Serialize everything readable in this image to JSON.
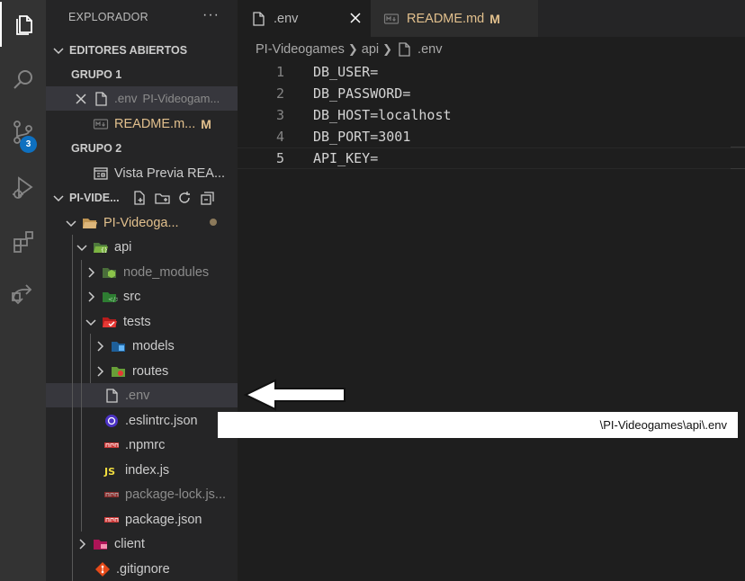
{
  "activity_bar": {
    "items": [
      {
        "icon": "files-icon",
        "active": true
      },
      {
        "icon": "search-icon"
      },
      {
        "icon": "source-control-icon",
        "badge": "3"
      },
      {
        "icon": "run-debug-icon"
      },
      {
        "icon": "extensions-icon"
      },
      {
        "icon": "remote-icon"
      }
    ]
  },
  "sidebar": {
    "title": "EXPLORADOR",
    "more": "···",
    "open_editors": {
      "label": "EDITORES ABIERTOS",
      "group1": "GRUPO 1",
      "item_env": {
        "name": ".env",
        "desc": "PI-Videogam..."
      },
      "item_readme": {
        "name": "README.m...",
        "badge": "M"
      },
      "group2": "GRUPO 2",
      "item_preview": {
        "name": "Vista Previa REA..."
      }
    },
    "folder": {
      "label": "PI-VIDE...",
      "root": "PI-Videoga...",
      "tree": [
        {
          "name": "api"
        },
        {
          "name": "node_modules"
        },
        {
          "name": "src"
        },
        {
          "name": "tests"
        },
        {
          "name": "models"
        },
        {
          "name": "routes"
        },
        {
          "name": ".env"
        },
        {
          "name": ".eslintrc.json"
        },
        {
          "name": ".npmrc"
        },
        {
          "name": "index.js"
        },
        {
          "name": "package-lock.js..."
        },
        {
          "name": "package.json"
        },
        {
          "name": "client"
        },
        {
          "name": ".gitignore"
        }
      ]
    }
  },
  "tabs": [
    {
      "label": ".env",
      "active": true
    },
    {
      "label": "README.md",
      "badge": "M"
    }
  ],
  "breadcrumb": [
    "PI-Videogames",
    "api",
    ".env"
  ],
  "editor": {
    "lines": [
      {
        "n": "1",
        "text": "DB_USER="
      },
      {
        "n": "2",
        "text": "DB_PASSWORD="
      },
      {
        "n": "3",
        "text": "DB_HOST=localhost"
      },
      {
        "n": "4",
        "text": "DB_PORT=3001"
      },
      {
        "n": "5",
        "text": "API_KEY="
      }
    ]
  },
  "tooltip": {
    "path": "\\PI-Videogames\\api\\.env"
  },
  "colors": {
    "accent": "#0e70c0",
    "modified": "#e2c08d",
    "sidebar": "#252526",
    "editor": "#1e1e1e"
  }
}
